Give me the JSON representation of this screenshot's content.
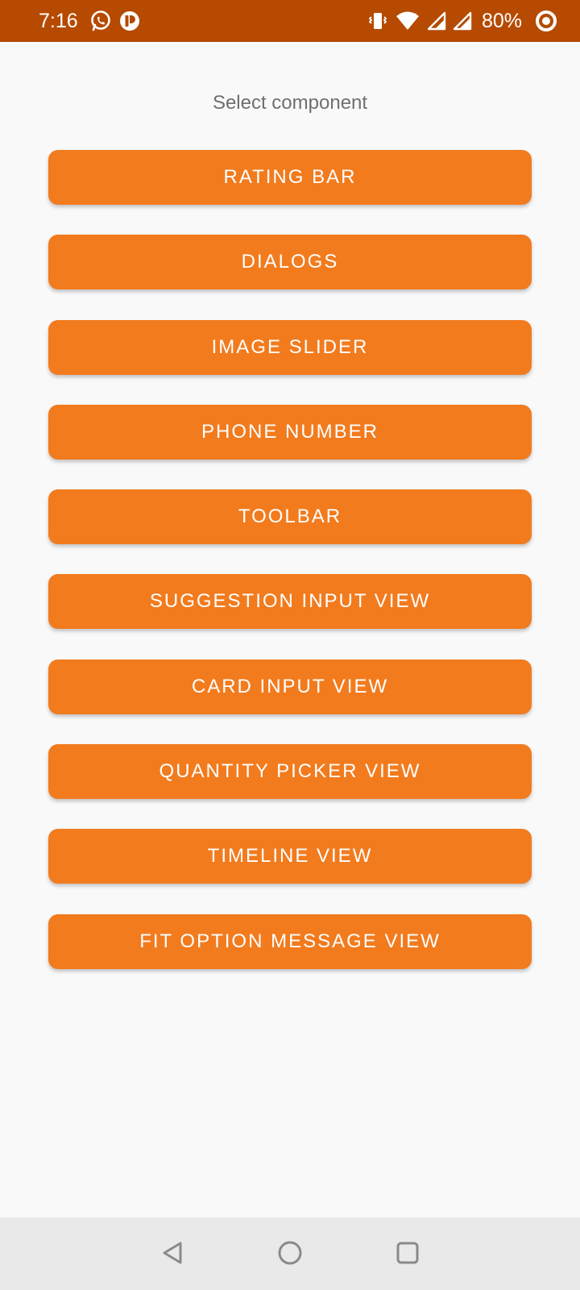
{
  "status_bar": {
    "time": "7:16",
    "battery": "80%",
    "icons_left": [
      "whatsapp-icon",
      "app-notification-icon"
    ],
    "icons_right": [
      "vibrate-icon",
      "wifi-icon",
      "signal-icon",
      "signal-icon-2",
      "battery-ring-icon"
    ],
    "background": "#B54A00"
  },
  "main": {
    "title": "Select component",
    "buttons": [
      {
        "label": "RATING BAR"
      },
      {
        "label": "DIALOGS"
      },
      {
        "label": "IMAGE SLIDER"
      },
      {
        "label": "PHONE NUMBER"
      },
      {
        "label": "TOOLBAR"
      },
      {
        "label": "SUGGESTION INPUT VIEW"
      },
      {
        "label": "CARD INPUT VIEW"
      },
      {
        "label": "QUANTITY PICKER VIEW"
      },
      {
        "label": "TIMELINE VIEW"
      },
      {
        "label": "FIT OPTION MESSAGE VIEW"
      }
    ],
    "button_color": "#F27B1E",
    "background": "#F9F9FA"
  },
  "nav_bar": {
    "icons": [
      "back-icon",
      "home-icon",
      "recents-icon"
    ]
  }
}
